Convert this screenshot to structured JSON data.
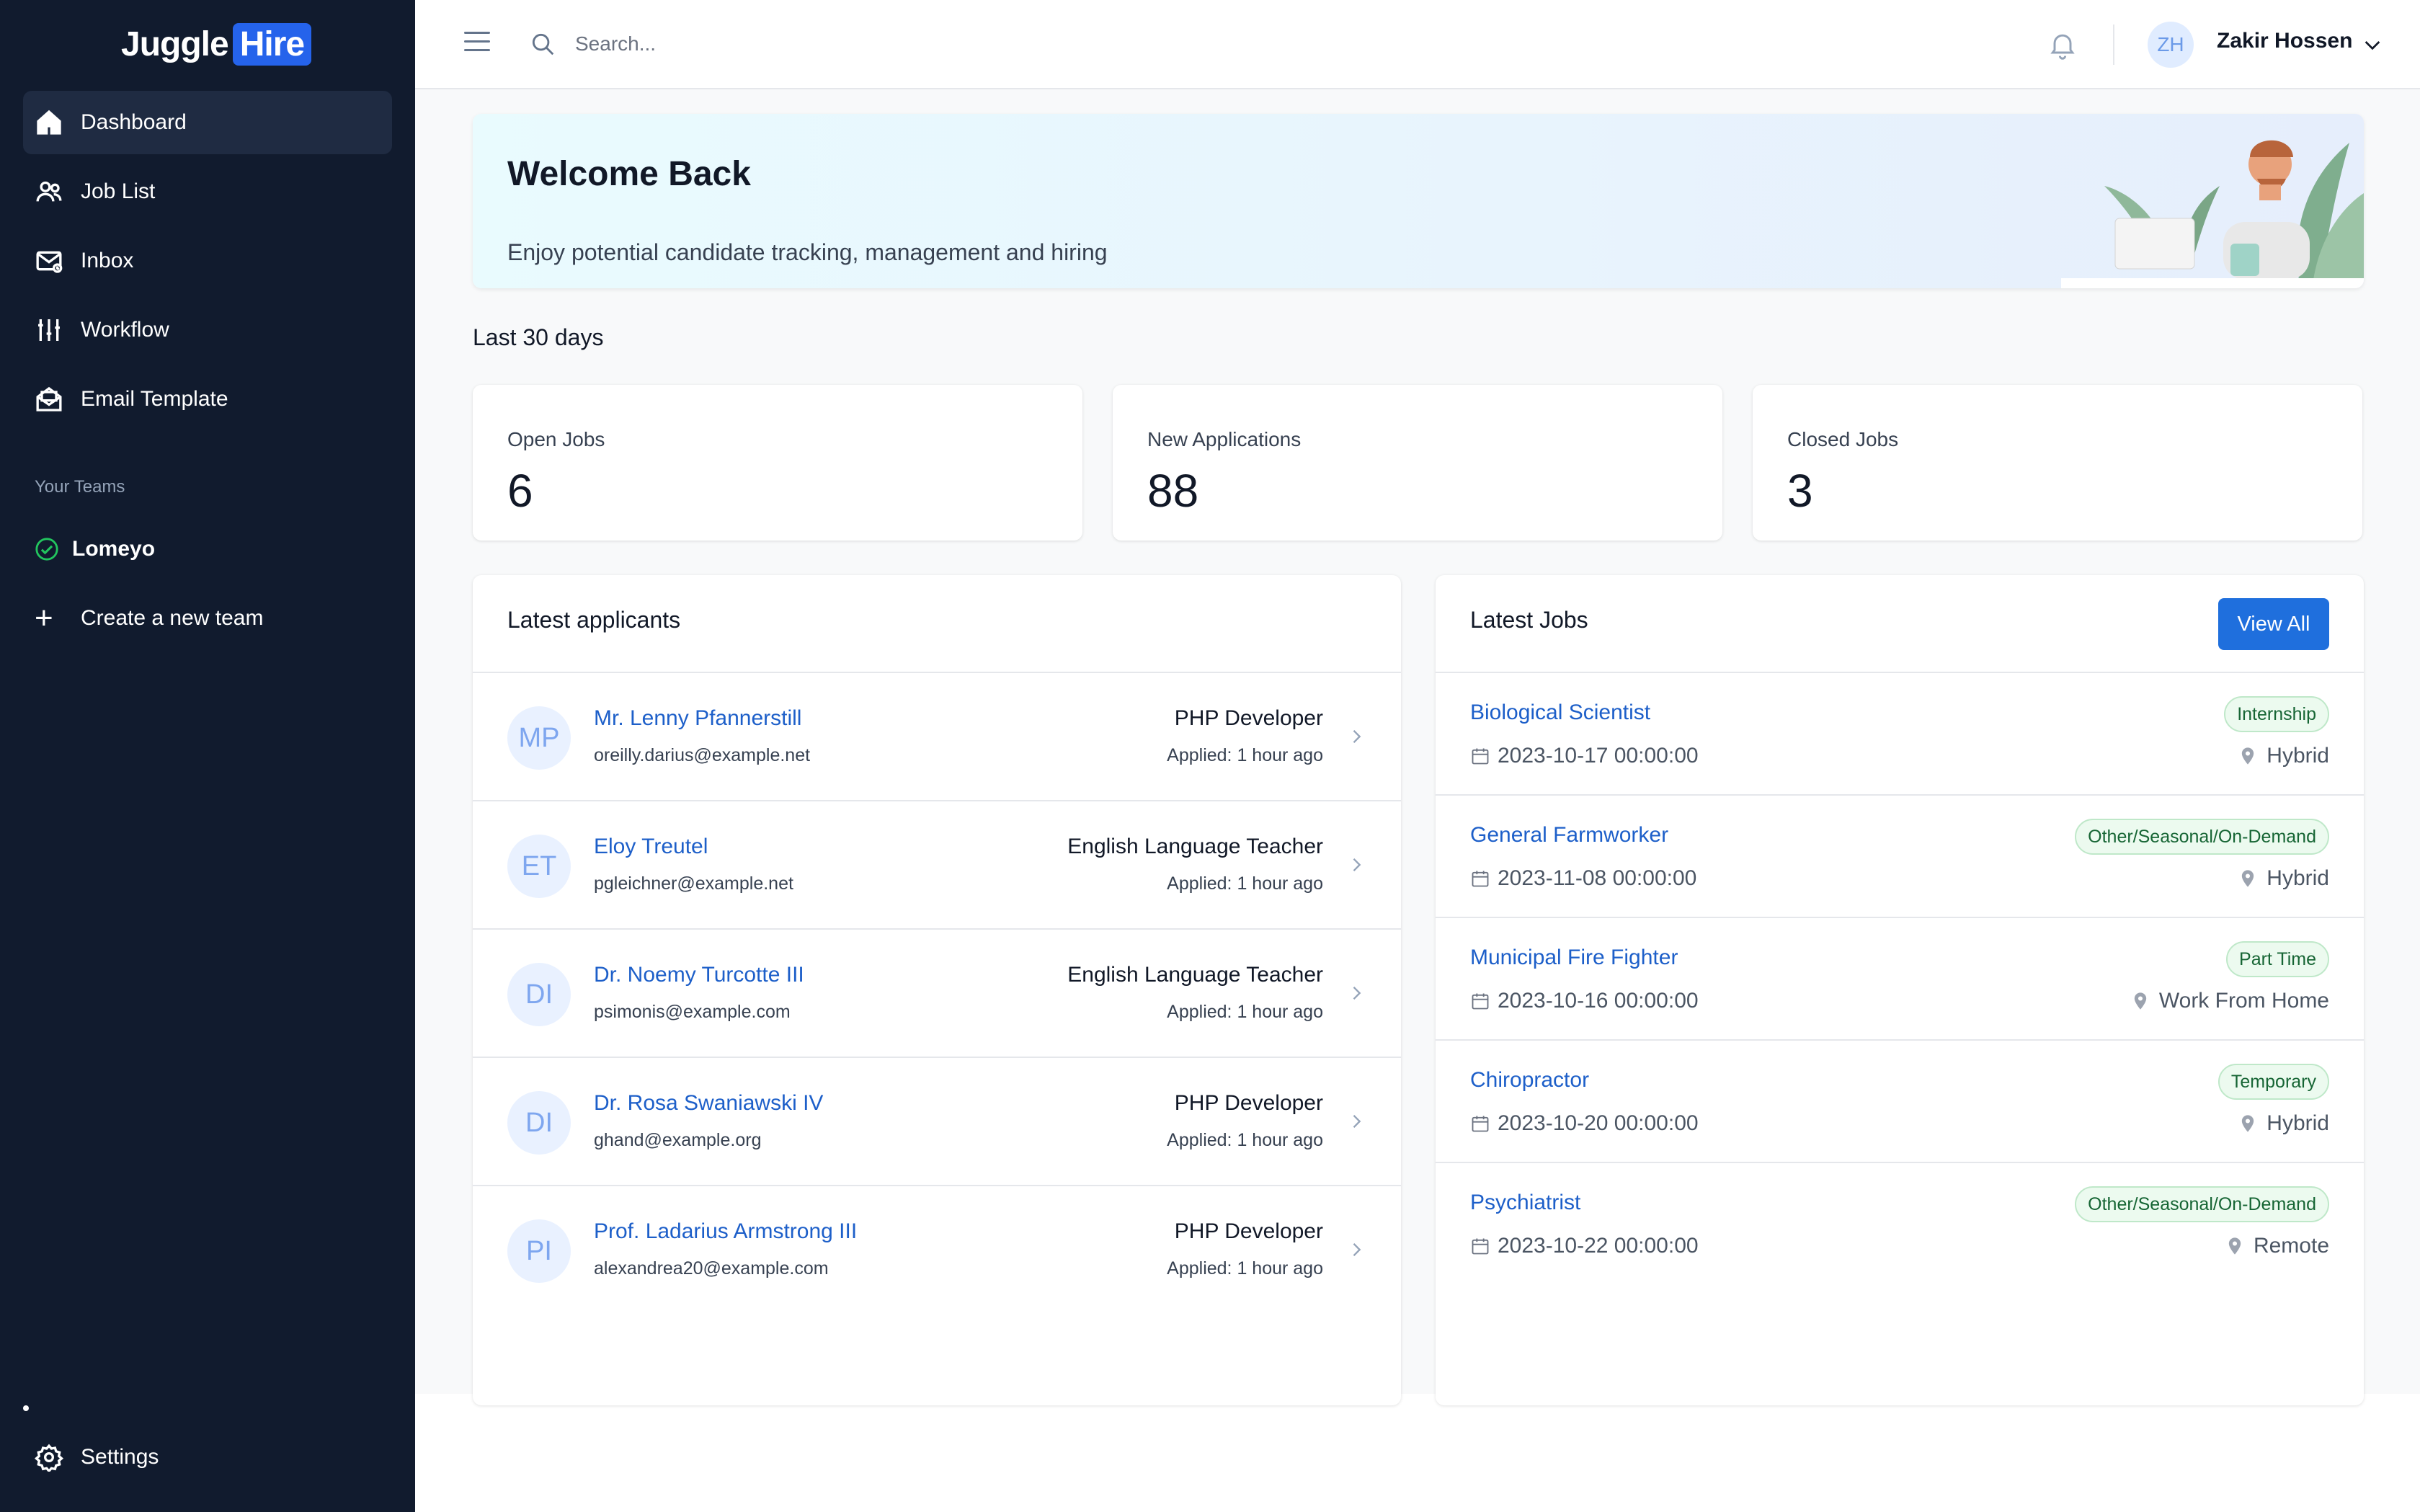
{
  "brand": {
    "name_part1": "Juggle",
    "name_part2": "Hire"
  },
  "sidebar": {
    "items": [
      {
        "label": "Dashboard",
        "icon": "home-icon",
        "active": true
      },
      {
        "label": "Job List",
        "icon": "users-icon"
      },
      {
        "label": "Inbox",
        "icon": "inbox-icon"
      },
      {
        "label": "Workflow",
        "icon": "sliders-icon"
      },
      {
        "label": "Email Template",
        "icon": "mail-open-icon"
      }
    ],
    "teams_label": "Your Teams",
    "team": "Lomeyo",
    "create_team": "Create a new team",
    "settings": "Settings"
  },
  "topbar": {
    "search_placeholder": "Search...",
    "user_initials": "ZH",
    "user_name": "Zakir Hossen"
  },
  "banner": {
    "title": "Welcome Back",
    "subtitle": "Enjoy potential candidate tracking, management and hiring"
  },
  "period": "Last 30 days",
  "stats": [
    {
      "label": "Open Jobs",
      "value": "6"
    },
    {
      "label": "New Applications",
      "value": "88"
    },
    {
      "label": "Closed Jobs",
      "value": "3"
    }
  ],
  "applicants": {
    "title": "Latest applicants",
    "items": [
      {
        "initials": "MP",
        "name": "Mr. Lenny Pfannerstill",
        "email": "oreilly.darius@example.net",
        "role": "PHP Developer",
        "time": "Applied: 1 hour ago"
      },
      {
        "initials": "ET",
        "name": "Eloy Treutel",
        "email": "pgleichner@example.net",
        "role": "English Language Teacher",
        "time": "Applied: 1 hour ago"
      },
      {
        "initials": "DI",
        "name": "Dr. Noemy Turcotte III",
        "email": "psimonis@example.com",
        "role": "English Language Teacher",
        "time": "Applied: 1 hour ago"
      },
      {
        "initials": "DI",
        "name": "Dr. Rosa Swaniawski IV",
        "email": "ghand@example.org",
        "role": "PHP Developer",
        "time": "Applied: 1 hour ago"
      },
      {
        "initials": "PI",
        "name": "Prof. Ladarius Armstrong III",
        "email": "alexandrea20@example.com",
        "role": "PHP Developer",
        "time": "Applied: 1 hour ago"
      }
    ]
  },
  "jobs": {
    "title": "Latest Jobs",
    "view_all": "View All",
    "items": [
      {
        "title": "Biological Scientist",
        "date": "2023-10-17 00:00:00",
        "tag": "Internship",
        "location": "Hybrid"
      },
      {
        "title": "General Farmworker",
        "date": "2023-11-08 00:00:00",
        "tag": "Other/Seasonal/On-Demand",
        "location": "Hybrid"
      },
      {
        "title": "Municipal Fire Fighter",
        "date": "2023-10-16 00:00:00",
        "tag": "Part Time",
        "location": "Work From Home"
      },
      {
        "title": "Chiropractor",
        "date": "2023-10-20 00:00:00",
        "tag": "Temporary",
        "location": "Hybrid"
      },
      {
        "title": "Psychiatrist",
        "date": "2023-10-22 00:00:00",
        "tag": "Other/Seasonal/On-Demand",
        "location": "Remote"
      }
    ]
  },
  "colors": {
    "sidebar_bg": "#111b2e",
    "accent": "#1f6fdd",
    "link": "#1d5fc9",
    "tag_green": "#166534"
  }
}
